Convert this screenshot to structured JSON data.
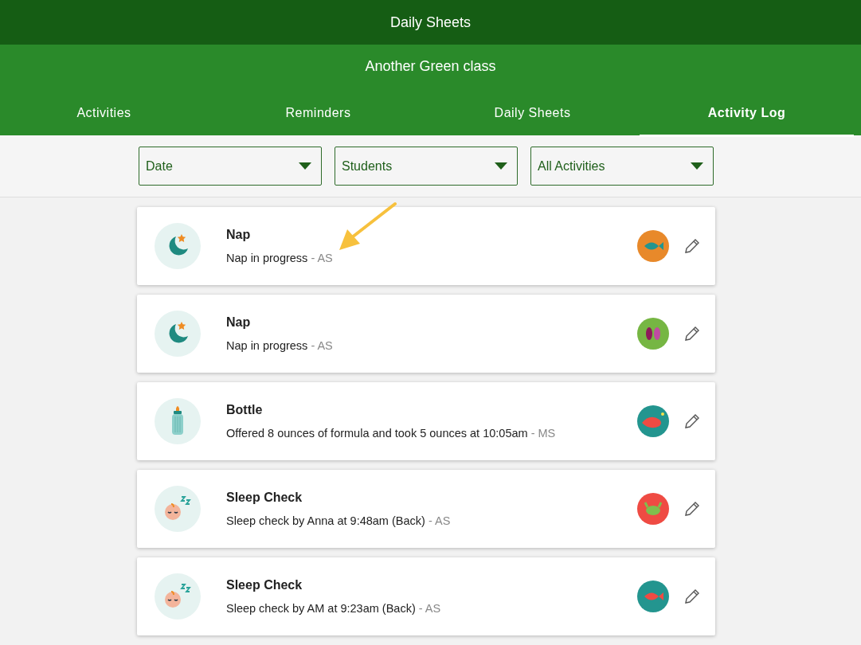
{
  "header": {
    "title": "Daily Sheets"
  },
  "class_bar": {
    "title": "Another Green class"
  },
  "tabs": [
    {
      "label": "Activities",
      "selected": false
    },
    {
      "label": "Reminders",
      "selected": false
    },
    {
      "label": "Daily Sheets",
      "selected": false
    },
    {
      "label": "Activity Log",
      "selected": true
    }
  ],
  "filters": [
    {
      "label": "Date"
    },
    {
      "label": "Students"
    },
    {
      "label": "All Activities"
    }
  ],
  "entries": [
    {
      "kind": "nap",
      "title": "Nap",
      "detail": "Nap in progress",
      "staff": "- AS",
      "avatar": {
        "kind": "fish",
        "color": "#e8892a"
      }
    },
    {
      "kind": "nap",
      "title": "Nap",
      "detail": "Nap in progress",
      "staff": "- AS",
      "avatar": {
        "kind": "fish_pair",
        "color": "#76b643"
      }
    },
    {
      "kind": "bottle",
      "title": "Bottle",
      "detail": "Offered 8 ounces of formula and took 5 ounces at 10:05am",
      "staff": "- MS",
      "avatar": {
        "kind": "anglerfish",
        "color": "#23958f"
      }
    },
    {
      "kind": "sleep_check",
      "title": "Sleep Check",
      "detail": "Sleep check by Anna at 9:48am (Back)",
      "staff": "- AS",
      "avatar": {
        "kind": "crab",
        "color": "#ef4b43"
      }
    },
    {
      "kind": "sleep_check",
      "title": "Sleep Check",
      "detail": "Sleep check by AM at 9:23am (Back)",
      "staff": "- AS",
      "avatar": {
        "kind": "fish",
        "color": "#23958f"
      }
    }
  ]
}
